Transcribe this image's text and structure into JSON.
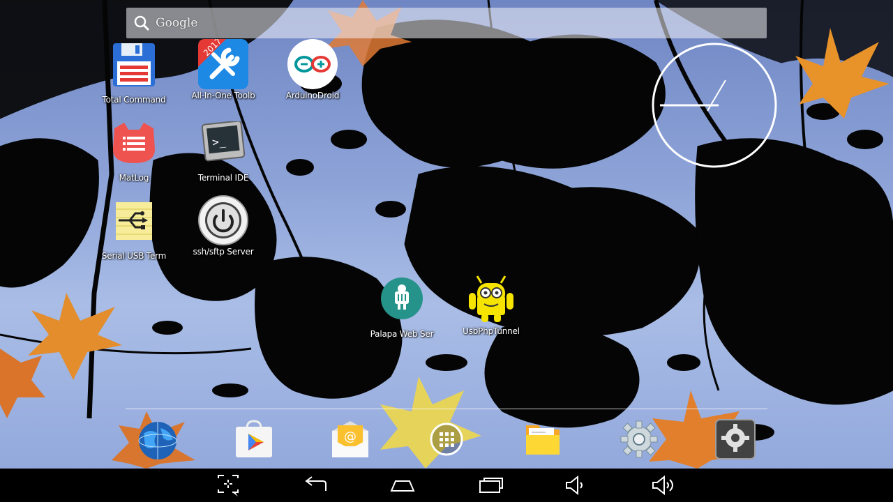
{
  "search": {
    "label": "Google",
    "icon": "search-icon"
  },
  "apps": [
    {
      "label": "Total Command",
      "icon": "floppy-disk-icon"
    },
    {
      "label": "All-In-One Toolb",
      "icon": "toolbox-2017-icon",
      "badge": "2017"
    },
    {
      "label": "ArduinoDroid",
      "icon": "arduino-icon"
    },
    {
      "label": "MatLog",
      "icon": "cat-log-icon"
    },
    {
      "label": "Terminal IDE",
      "icon": "terminal-icon",
      "glyph": ">_"
    },
    {
      "label": "Serial USB Term",
      "icon": "usb-serial-icon"
    },
    {
      "label": "ssh/sftp Server",
      "icon": "power-icon"
    },
    {
      "label": "Palapa Web Ser",
      "icon": "android-server-icon"
    },
    {
      "label": "UsbPhpTunnel",
      "icon": "android-robot-icon"
    }
  ],
  "clock_widget": {
    "icon": "analog-clock-icon"
  },
  "dock": [
    {
      "name": "browser-globe-icon"
    },
    {
      "name": "play-store-icon"
    },
    {
      "name": "email-icon"
    },
    {
      "name": "app-drawer-icon"
    },
    {
      "name": "file-manager-icon"
    },
    {
      "name": "settings-gear-icon"
    },
    {
      "name": "system-settings-icon"
    }
  ],
  "navbar": [
    {
      "name": "screenshot-icon"
    },
    {
      "name": "back-icon"
    },
    {
      "name": "home-icon"
    },
    {
      "name": "recents-icon"
    },
    {
      "name": "volume-down-icon"
    },
    {
      "name": "volume-up-icon"
    }
  ],
  "colors": {
    "sky": "#8ea4d8",
    "navbar": "#000000",
    "leaf_orange": "#e8892a",
    "leaf_yellow": "#e6d35a"
  }
}
